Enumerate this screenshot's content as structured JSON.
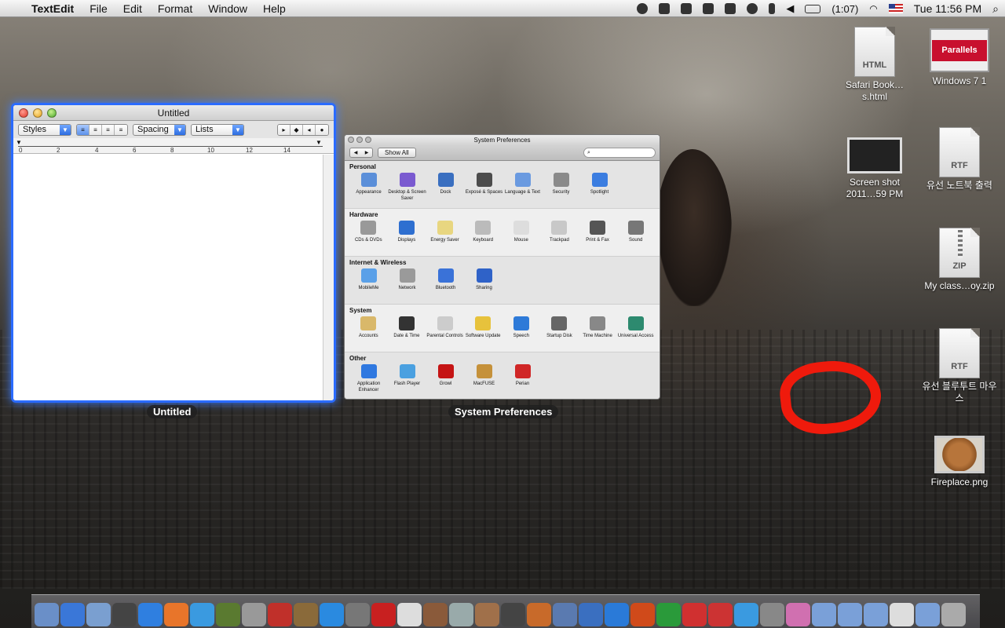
{
  "menubar": {
    "app": "TextEdit",
    "items": [
      "File",
      "Edit",
      "Format",
      "Window",
      "Help"
    ],
    "battery": "(1:07)",
    "clock": "Tue 11:56 PM"
  },
  "textedit": {
    "title": "Untitled",
    "styles": "Styles",
    "spacing": "Spacing",
    "lists": "Lists",
    "ruler": [
      "0",
      "2",
      "4",
      "6",
      "8",
      "10",
      "12",
      "14"
    ],
    "label": "Untitled"
  },
  "sysprefs": {
    "title": "System Preferences",
    "show_all": "Show All",
    "search_placeholder": "",
    "label": "System Preferences",
    "sections": [
      {
        "name": "Personal",
        "panes": [
          "Appearance",
          "Desktop & Screen Saver",
          "Dock",
          "Exposé & Spaces",
          "Language & Text",
          "Security",
          "Spotlight"
        ]
      },
      {
        "name": "Hardware",
        "panes": [
          "CDs & DVDs",
          "Displays",
          "Energy Saver",
          "Keyboard",
          "Mouse",
          "Trackpad",
          "Print & Fax",
          "Sound"
        ]
      },
      {
        "name": "Internet & Wireless",
        "panes": [
          "MobileMe",
          "Network",
          "Bluetooth",
          "Sharing"
        ]
      },
      {
        "name": "System",
        "panes": [
          "Accounts",
          "Date & Time",
          "Parental Controls",
          "Software Update",
          "Speech",
          "Startup Disk",
          "Time Machine",
          "Universal Access"
        ]
      },
      {
        "name": "Other",
        "panes": [
          "Application Enhancer",
          "Flash Player",
          "Growl",
          "MacFUSE",
          "Perian"
        ]
      }
    ]
  },
  "desktop": {
    "icons": [
      {
        "label": "Safari Book…s.html",
        "type": "HTML"
      },
      {
        "label": "Windows 7 1",
        "type": "Parallels"
      },
      {
        "label": "Screen shot 2011…59 PM",
        "type": ""
      },
      {
        "label": "유선 노트북 출력",
        "type": "RTF"
      },
      {
        "label": "My class…oy.zip",
        "type": "ZIP"
      },
      {
        "label": "유선 블루투트 마우스",
        "type": "RTF"
      },
      {
        "label": "Fireplace.png",
        "type": ""
      }
    ]
  },
  "colors": {
    "highlight": "#2a6bff",
    "scribble": "#ef1a0c"
  }
}
